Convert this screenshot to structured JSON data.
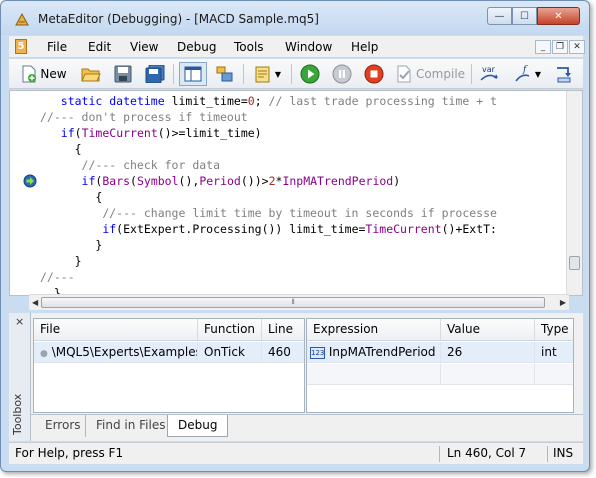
{
  "window": {
    "title": "MetaEditor (Debugging) - [MACD Sample.mq5]",
    "caption_buttons": {
      "minimize": "—",
      "maximize": "☐",
      "close": "✕"
    }
  },
  "menubar": {
    "doc_icon": "5",
    "items": [
      "File",
      "Edit",
      "View",
      "Debug",
      "Tools",
      "Window",
      "Help"
    ],
    "mdi_buttons": {
      "minimize": "_",
      "restore": "❐",
      "close": "✕"
    }
  },
  "toolbar": {
    "new_label": "New",
    "compile_label": "Compile",
    "var_label": "var",
    "icons": [
      "new-file-icon",
      "open-folder-icon",
      "save-icon",
      "save-all-icon",
      "navigator-icon",
      "toolbox-icon",
      "styler-icon",
      "start-debug-icon",
      "pause-icon",
      "stop-icon",
      "compile-icon",
      "watch-var-icon",
      "function-icon",
      "debug-step-icon"
    ]
  },
  "editor": {
    "lines": [
      {
        "indent": "   ",
        "tokens": [
          [
            "kw",
            "static "
          ],
          [
            "kw",
            "datetime "
          ],
          [
            "var",
            "limit_time"
          ],
          [
            "var",
            "="
          ],
          [
            "num",
            "0"
          ],
          [
            "var",
            "; "
          ],
          [
            "cm",
            "// last trade processing time + t"
          ]
        ]
      },
      {
        "indent": "",
        "tokens": [
          [
            "cm",
            "//--- don't process if timeout"
          ]
        ]
      },
      {
        "indent": "   ",
        "tokens": [
          [
            "kw",
            "if"
          ],
          [
            "var",
            "("
          ],
          [
            "fn",
            "TimeCurrent"
          ],
          [
            "var",
            "()>=limit_time)"
          ]
        ]
      },
      {
        "indent": "     ",
        "tokens": [
          [
            "var",
            "{"
          ]
        ]
      },
      {
        "indent": "      ",
        "tokens": [
          [
            "cm",
            "//--- check for data"
          ]
        ]
      },
      {
        "indent": "      ",
        "tokens": [
          [
            "kw",
            "if"
          ],
          [
            "var",
            "("
          ],
          [
            "fn",
            "Bars"
          ],
          [
            "var",
            "("
          ],
          [
            "fn",
            "Symbol"
          ],
          [
            "var",
            "(),"
          ],
          [
            "fn",
            "Period"
          ],
          [
            "var",
            "())>"
          ],
          [
            "num",
            "2"
          ],
          [
            "var",
            "*"
          ],
          [
            "fn",
            "InpMATrendPeriod"
          ],
          [
            "var",
            ")"
          ]
        ]
      },
      {
        "indent": "        ",
        "tokens": [
          [
            "var",
            "{"
          ]
        ]
      },
      {
        "indent": "         ",
        "tokens": [
          [
            "cm",
            "//--- change limit time by timeout in seconds if processe"
          ]
        ]
      },
      {
        "indent": "         ",
        "tokens": [
          [
            "kw",
            "if"
          ],
          [
            "var",
            "(ExtExpert.Processing()) limit_time="
          ],
          [
            "fn",
            "TimeCurrent"
          ],
          [
            "var",
            "()+ExtT:"
          ]
        ]
      },
      {
        "indent": "        ",
        "tokens": [
          [
            "var",
            "}"
          ]
        ]
      },
      {
        "indent": "     ",
        "tokens": [
          [
            "var",
            "}"
          ]
        ]
      },
      {
        "indent": "",
        "tokens": [
          [
            "cm",
            "//---"
          ]
        ]
      },
      {
        "indent": "  ",
        "tokens": [
          [
            "var",
            "}"
          ]
        ]
      }
    ],
    "current_line_index": 5
  },
  "call_stack": {
    "headers": [
      "File",
      "Function",
      "Line"
    ],
    "rows": [
      {
        "file": "\\MQL5\\Experts\\Examples...",
        "function": "OnTick",
        "line": "460"
      }
    ]
  },
  "watch": {
    "headers": [
      "Expression",
      "Value",
      "Type"
    ],
    "rows": [
      {
        "expression": "InpMATrendPeriod",
        "value": "26",
        "type": "int"
      }
    ]
  },
  "toolbox": {
    "label": "Toolbox",
    "close_glyph": "×",
    "tabs": [
      "Errors",
      "Find in Files",
      "Debug"
    ],
    "active_tab": "Debug"
  },
  "statusbar": {
    "help": "For Help, press F1",
    "position": "Ln 460, Col 7",
    "mode": "INS"
  },
  "colors": {
    "keyword": "#0000ff",
    "comment": "#808080",
    "function": "#8b008b",
    "number": "#b22222",
    "window_frame": "#c9dcf0"
  }
}
